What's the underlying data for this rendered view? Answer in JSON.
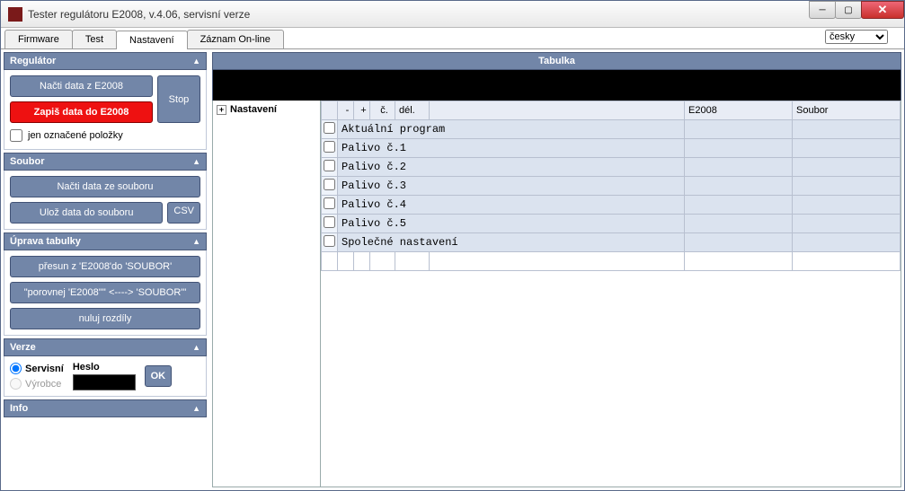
{
  "window": {
    "title": "Tester regulátoru E2008, v.4.06, servisní verze"
  },
  "tabs": {
    "t0": "Firmware",
    "t1": "Test",
    "t2": "Nastavení",
    "t3": "Záznam On-line"
  },
  "lang": {
    "selected": "česky"
  },
  "sidebar": {
    "regulator": {
      "title": "Regulátor",
      "read": "Načti data z E2008",
      "write": "Zapiš data do E2008",
      "stop": "Stop",
      "only_checked": "jen označené položky"
    },
    "soubor": {
      "title": "Soubor",
      "read": "Načti data ze souboru",
      "save": "Ulož data do souboru",
      "csv": "CSV"
    },
    "uprava": {
      "title": "Úprava tabulky",
      "move": "přesun z 'E2008'do 'SOUBOR'",
      "compare": "\"porovnej 'E2008'\"' <----> 'SOUBOR'\"",
      "reset": "nuluj rozdíly"
    },
    "verze": {
      "title": "Verze",
      "servisni": "Servisní",
      "vyrobce": "Výrobce",
      "heslo": "Heslo",
      "ok": "OK"
    },
    "info": {
      "title": "Info"
    }
  },
  "main": {
    "title": "Tabulka",
    "tree_root": "Nastavení",
    "cols": {
      "minus": "-",
      "plus": "+",
      "num": "č.",
      "del": "dél.",
      "e2008": "E2008",
      "soubor": "Soubor"
    },
    "rows": [
      "Aktuální program",
      "Palivo č.1",
      "Palivo č.2",
      "Palivo č.3",
      "Palivo č.4",
      "Palivo č.5",
      "Společné nastavení"
    ]
  },
  "chart_data": null
}
